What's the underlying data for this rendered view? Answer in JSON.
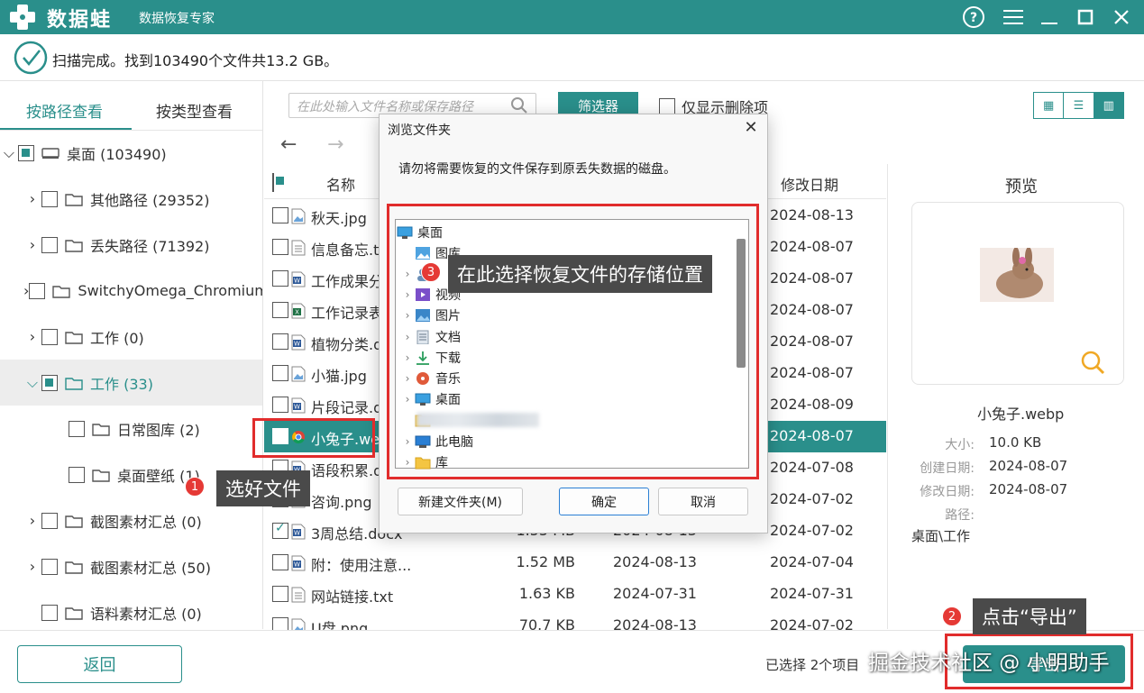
{
  "app": {
    "brand": "数据蛙",
    "subtitle": "数据恢复专家"
  },
  "status": {
    "text": "扫描完成。找到103490个文件共13.2 GB。"
  },
  "tabs": {
    "by_path": "按路径查看",
    "by_type": "按类型查看"
  },
  "tree": [
    {
      "label": "桌面 (103490)",
      "expanded": true,
      "state": "partial",
      "level": 0
    },
    {
      "label": "其他路径 (29352)",
      "state": "none",
      "level": 1
    },
    {
      "label": "丢失路径 (71392)",
      "state": "none",
      "level": 1
    },
    {
      "label": "SwitchyOmega_Chromium",
      "state": "none",
      "level": 1
    },
    {
      "label": "工作 (0)",
      "state": "none",
      "level": 1
    },
    {
      "label": "工作 (33)",
      "expanded": true,
      "state": "partial",
      "level": 1,
      "selected": true
    },
    {
      "label": "日常图库 (2)",
      "state": "none",
      "level": 2
    },
    {
      "label": "桌面壁纸 (1)",
      "state": "none",
      "level": 2
    },
    {
      "label": "截图素材汇总 (0)",
      "state": "none",
      "level": 1
    },
    {
      "label": "截图素材汇总 (50)",
      "state": "none",
      "level": 1
    },
    {
      "label": "语料素材汇总 (0)",
      "state": "none",
      "level": 1
    }
  ],
  "toolbar": {
    "search_placeholder": "在此处输入文件名称或保存路径",
    "filter_label": "筛选器",
    "only_deleted_label": "仅显示删除项"
  },
  "list": {
    "col_name": "名称",
    "col_modified": "修改日期",
    "rows": [
      {
        "name": "秋天.jpg",
        "size": "",
        "created": "",
        "modified": "2024-08-13",
        "icon": "image",
        "checked": false
      },
      {
        "name": "信息备忘.t",
        "size": "",
        "created": "",
        "modified": "2024-08-07",
        "icon": "text",
        "checked": false
      },
      {
        "name": "工作成果分",
        "size": "",
        "created": "",
        "modified": "2024-08-07",
        "icon": "word",
        "checked": false
      },
      {
        "name": "工作记录表",
        "size": "",
        "created": "",
        "modified": "2024-08-07",
        "icon": "excel",
        "checked": false
      },
      {
        "name": "植物分类.d",
        "size": "",
        "created": "",
        "modified": "2024-08-07",
        "icon": "word",
        "checked": false
      },
      {
        "name": "小猫.jpg",
        "size": "",
        "created": "",
        "modified": "2024-08-07",
        "icon": "image",
        "checked": false
      },
      {
        "name": "片段记录.d",
        "size": "",
        "created": "",
        "modified": "2024-08-09",
        "icon": "word",
        "checked": false
      },
      {
        "name": "小兔子.we",
        "size": "",
        "created": "",
        "modified": "2024-08-07",
        "icon": "chrome",
        "checked": true,
        "selected": true
      },
      {
        "name": "语段积累.d",
        "size": "",
        "created": "",
        "modified": "2024-07-08",
        "icon": "word",
        "checked": false
      },
      {
        "name": "咨询.png",
        "size": "",
        "created": "",
        "modified": "2024-07-02",
        "icon": "image",
        "checked": false
      },
      {
        "name": "3周总结.docx",
        "size": "1.55 MB",
        "created": "2024-08-13",
        "modified": "2024-07-02",
        "icon": "word",
        "checked": true
      },
      {
        "name": "附：使用注意...",
        "size": "1.52 MB",
        "created": "2024-08-13",
        "modified": "2024-07-04",
        "icon": "word",
        "checked": false
      },
      {
        "name": "网站链接.txt",
        "size": "1.63 KB",
        "created": "2024-07-31",
        "modified": "2024-07-31",
        "icon": "text",
        "checked": false
      },
      {
        "name": "U盘.png",
        "size": "70.7 KB",
        "created": "2024-08-13",
        "modified": "2024-07-02",
        "icon": "image",
        "checked": false
      }
    ]
  },
  "preview": {
    "title": "预览",
    "file_name": "小兔子.webp",
    "size_label": "大小:",
    "size_value": "10.0 KB",
    "created_label": "创建日期:",
    "created_value": "2024-08-07",
    "modified_label": "修改日期:",
    "modified_value": "2024-08-07",
    "path_label": "路径:",
    "path_value": "桌面\\工作"
  },
  "footer": {
    "back_label": "返回",
    "selected_info": "已选择 2个项目",
    "export_label": "导出"
  },
  "dialog": {
    "title": "浏览文件夹",
    "message": "请勿将需要恢复的文件保存到原丢失数据的磁盘。",
    "items": [
      {
        "label": "桌面",
        "icon": "desktop",
        "chevron": false,
        "indent": 0
      },
      {
        "label": "图库",
        "icon": "gallery",
        "chevron": false,
        "indent": 1
      },
      {
        "label": "",
        "icon": "user",
        "chevron": true,
        "indent": 1
      },
      {
        "label": "视频",
        "icon": "video",
        "chevron": true,
        "indent": 1
      },
      {
        "label": "图片",
        "icon": "pictures",
        "chevron": true,
        "indent": 1
      },
      {
        "label": "文档",
        "icon": "docs",
        "chevron": true,
        "indent": 1
      },
      {
        "label": "下载",
        "icon": "download",
        "chevron": true,
        "indent": 1
      },
      {
        "label": "音乐",
        "icon": "music",
        "chevron": true,
        "indent": 1
      },
      {
        "label": "桌面",
        "icon": "desktop",
        "chevron": true,
        "indent": 1
      },
      {
        "label": "",
        "icon": "folder",
        "chevron": false,
        "indent": 1
      },
      {
        "label": "此电脑",
        "icon": "pc",
        "chevron": true,
        "indent": 1
      },
      {
        "label": "库",
        "icon": "folder",
        "chevron": true,
        "indent": 1
      }
    ],
    "new_folder_label": "新建文件夹(M)",
    "ok_label": "确定",
    "cancel_label": "取消"
  },
  "annotations": {
    "step1_num": "1",
    "step1_text": "选好文件",
    "step2_num": "2",
    "step2_text": "点击“导出”",
    "step3_num": "3",
    "step3_text": "在此选择恢复文件的存储位置"
  },
  "watermark": "掘金技术社区 @ 小明助手",
  "colors": {
    "accent": "#2a8f8b",
    "annotation_red": "#e12c2c"
  }
}
